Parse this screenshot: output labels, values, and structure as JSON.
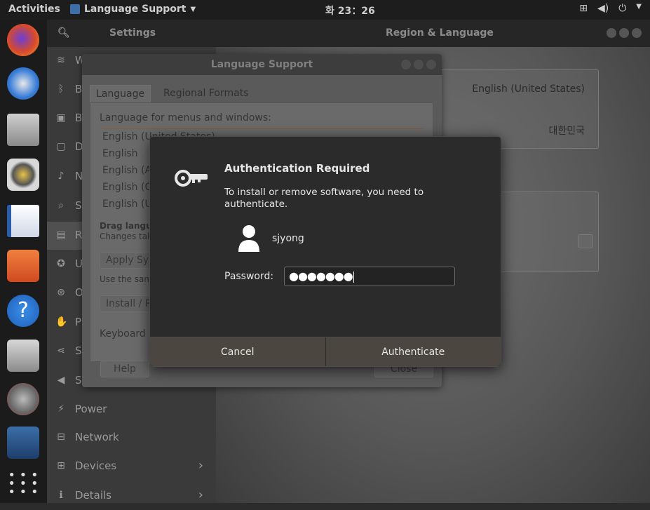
{
  "topbar": {
    "activities": "Activities",
    "app_name": "Language Support",
    "clock": "화 23：26"
  },
  "settings": {
    "title_left": "Settings",
    "title_right": "Region & Language",
    "sidebar": [
      {
        "label": "Wi-Fi",
        "icon": "wifi-icon"
      },
      {
        "label": "Bluetooth",
        "icon": "bluetooth-icon"
      },
      {
        "label": "Background",
        "icon": "background-icon"
      },
      {
        "label": "Dock",
        "icon": "dock-icon"
      },
      {
        "label": "Notifications",
        "icon": "bell-icon"
      },
      {
        "label": "Search",
        "icon": "search-icon"
      },
      {
        "label": "Region & Language",
        "icon": "region-icon"
      },
      {
        "label": "Universal Access",
        "icon": "accessibility-icon"
      },
      {
        "label": "Online Accounts",
        "icon": "online-accounts-icon"
      },
      {
        "label": "Privacy",
        "icon": "hand-icon"
      },
      {
        "label": "Sharing",
        "icon": "share-icon"
      },
      {
        "label": "Sound",
        "icon": "speaker-icon"
      },
      {
        "label": "Power",
        "icon": "power-icon"
      },
      {
        "label": "Network",
        "icon": "network-icon"
      },
      {
        "label": "Devices",
        "icon": "devices-icon"
      },
      {
        "label": "Details",
        "icon": "info-icon"
      }
    ],
    "language_value": "English (United States)",
    "formats_value": "대한민국"
  },
  "language_support": {
    "title": "Language Support",
    "tabs": [
      "Language",
      "Regional Formats"
    ],
    "list_heading": "Language for menus and windows:",
    "languages": [
      "English (United States)",
      "English",
      "English (Australia)",
      "English (Canada)",
      "English (United Kingdom)"
    ],
    "drag_hint": "Drag languages to arrange them in order of preference.",
    "changes_hint": "Changes take effect next time you log in.",
    "apply_button": "Apply System-Wide",
    "same_lang_hint": "Use the same language choices for startup and the login screen.",
    "install_button": "Install / Remove Languages...",
    "keyboard_label": "Keyboard input method system:",
    "help_button": "Help",
    "close_button": "Close"
  },
  "auth": {
    "title": "Authentication Required",
    "message": "To install or remove software, you need to authenticate.",
    "username": "sjyong",
    "password_label": "Password:",
    "password_value": "●●●●●●●",
    "cancel_label": "Cancel",
    "authenticate_label": "Authenticate"
  }
}
